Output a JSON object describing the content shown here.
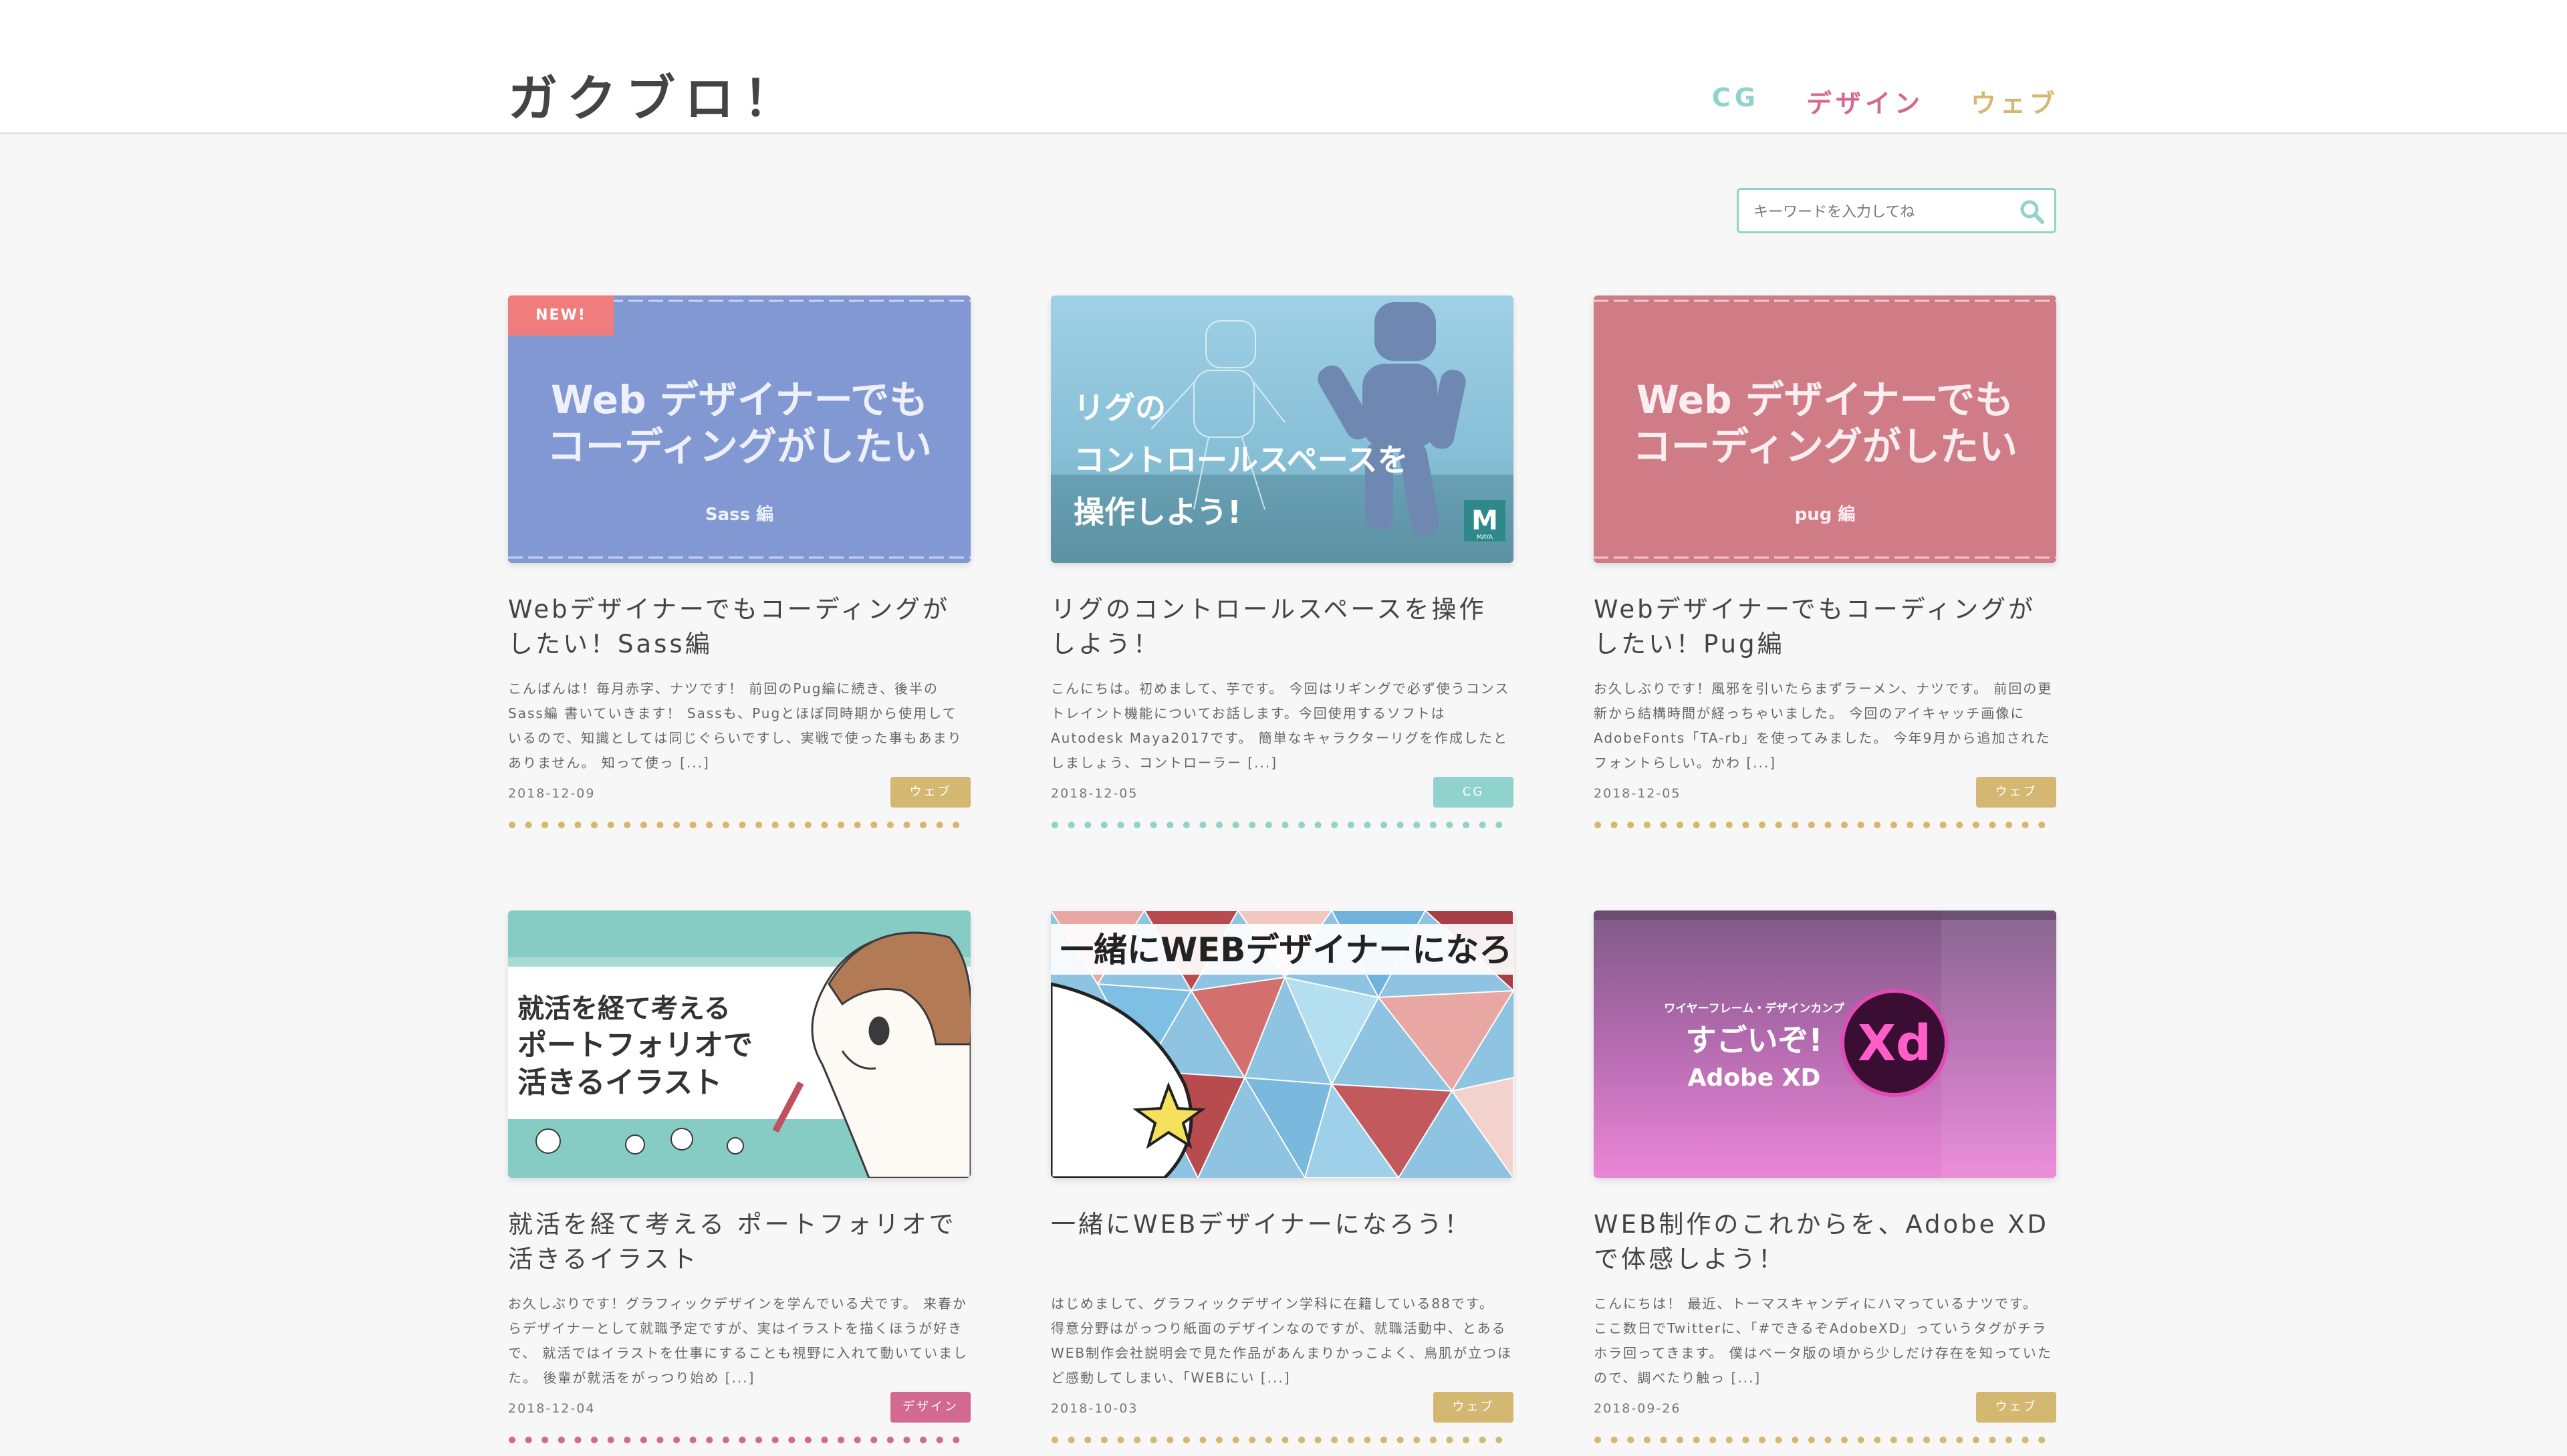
{
  "site": {
    "logo": "ガクブロ！"
  },
  "nav": [
    {
      "label": "CG",
      "color": "#8fd3cc"
    },
    {
      "label": "デザイン",
      "color": "#d2698f"
    },
    {
      "label": "ウェブ",
      "color": "#d4b771"
    }
  ],
  "search": {
    "placeholder": "キーワードを入力してね"
  },
  "colors": {
    "web": "#d4b771",
    "cg": "#8fd3cc",
    "design": "#d2698f",
    "new": "#ef7d7d"
  },
  "posts": [
    {
      "badge": "NEW!",
      "thumb_lines": [
        "Web デザイナーでも",
        "コーディングがしたい",
        "Sass 編"
      ],
      "title": "Webデザイナーでもコーディングがしたい！Sass編",
      "excerpt": "こんばんは！毎月赤字、ナツです！ 前回のPug編に続き、後半のSass編 書いていきます！ Sassも、Pugとほぼ同時期から使用しているので、知識としては同じぐらいですし、実戦で使った事もあまりありません。 知って使っ [...]",
      "date": "2018-12-09",
      "category": "ウェブ",
      "category_color": "#d4b771"
    },
    {
      "thumb_lines": [
        "リグの",
        "コントロールスペースを",
        "操作しよう!"
      ],
      "thumb_logo": "M",
      "thumb_logo_sub": "MAYA",
      "title": "リグのコントロールスペースを操作しよう！",
      "excerpt": "こんにちは。初めまして、芋です。 今回はリギングで必ず使うコンストレイント機能についてお話します。今回使用するソフトはAutodesk Maya2017です。 簡単なキャラクターリグを作成したとしましょう、コントローラー [...]",
      "date": "2018-12-05",
      "category": "CG",
      "category_color": "#8fd3cc"
    },
    {
      "thumb_lines": [
        "Web デザイナーでも",
        "コーディングがしたい",
        "pug 編"
      ],
      "title": "Webデザイナーでもコーディングがしたい！Pug編",
      "excerpt": "お久しぶりです！風邪を引いたらまずラーメン、ナツです。 前回の更新から結構時間が経っちゃいました。 今回のアイキャッチ画像にAdobeFonts「TA-rb」を使ってみました。 今年9月から追加されたフォントらしい。かわ [...]",
      "date": "2018-12-05",
      "category": "ウェブ",
      "category_color": "#d4b771"
    },
    {
      "thumb_lines": [
        "就活を経て考える",
        "ポートフォリオで",
        "活きるイラスト"
      ],
      "title": "就活を経て考える ポートフォリオで活きるイラスト",
      "excerpt": "お久しぶりです！グラフィックデザインを学んでいる犬です。 来春からデザイナーとして就職予定ですが、実はイラストを描くほうが好きで、 就活ではイラストを仕事にすることも視野に入れて動いていました。 後輩が就活をがっつり始め [...]",
      "date": "2018-12-04",
      "category": "デザイン",
      "category_color": "#d2698f"
    },
    {
      "thumb_lines": [
        "一緒にWEBデザイナーになろ"
      ],
      "title": "一緒にWEBデザイナーになろう！",
      "excerpt": "はじめまして、グラフィックデザイン学科に在籍している88です。 得意分野はがっつり紙面のデザインなのですが、就職活動中、とあるWEB制作会社説明会で見た作品があんまりかっこよく、鳥肌が立つほど感動してしまい、「WEBにい [...]",
      "date": "2018-10-03",
      "category": "ウェブ",
      "category_color": "#d4b771"
    },
    {
      "thumb_lines": [
        "ワイヤーフレーム・デザインカンプ",
        "すごいぞ!",
        "Adobe XD"
      ],
      "thumb_logo": "Xd",
      "title": "WEB制作のこれからを、Adobe XDで体感しよう！",
      "excerpt": "こんにちは！ 最近、トーマスキャンディにハマっているナツです。 ここ数日でTwitterに、「#できるぞAdobeXD」っていうタグがチラホラ回ってきます。 僕はベータ版の頃から少しだけ存在を知っていたので、調べたり触っ [...]",
      "date": "2018-09-26",
      "category": "ウェブ",
      "category_color": "#d4b771"
    }
  ]
}
